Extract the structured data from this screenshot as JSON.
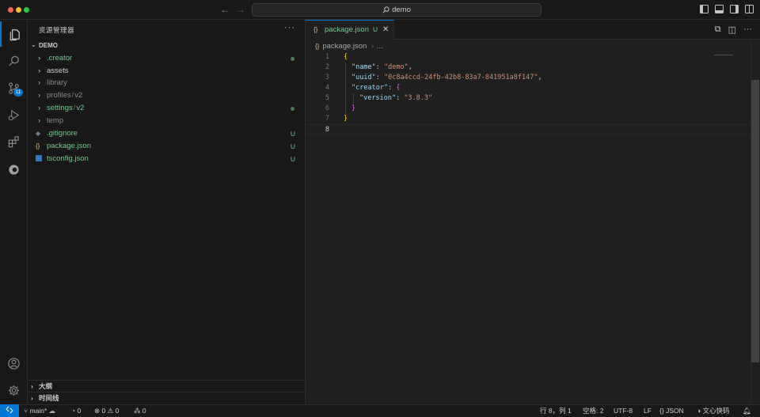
{
  "window": {
    "search_text": "demo"
  },
  "activity": {
    "scm_badge": "11"
  },
  "sidebar": {
    "title": "资源管理器",
    "more": "···",
    "root_folder": "DEMO",
    "items": [
      {
        "label": ".creator",
        "type": "folder",
        "status": "dot"
      },
      {
        "label": "assets",
        "type": "folder",
        "status": ""
      },
      {
        "label": "library",
        "type": "folder",
        "status": ""
      },
      {
        "label": "profiles",
        "label2": "v2",
        "type": "folder",
        "status": ""
      },
      {
        "label": "settings",
        "label2": "v2",
        "type": "folder",
        "status": "dot"
      },
      {
        "label": "temp",
        "type": "folder",
        "status": ""
      },
      {
        "label": ".gitignore",
        "type": "file",
        "status": "U"
      },
      {
        "label": "package.json",
        "type": "file",
        "status": "U"
      },
      {
        "label": "tsconfig.json",
        "type": "file",
        "status": "U"
      }
    ],
    "outline_label": "大纲",
    "timeline_label": "时间线"
  },
  "editor": {
    "tab_icon": "{}",
    "tab_name": "package.json",
    "tab_status": "U",
    "breadcrumb_file": "package.json",
    "breadcrumb_more": "…",
    "lines": [
      "{",
      "\"name\": \"demo\",",
      "\"uuid\": \"0c8a4ccd-24fb-42b8-83a7-841951a8f147\",",
      "\"creator\": {",
      "\"version\": \"3.8.3\"",
      "}",
      "}",
      ""
    ],
    "line_numbers": [
      "1",
      "2",
      "3",
      "4",
      "5",
      "6",
      "7",
      "8"
    ]
  },
  "statusbar": {
    "branch": "main*",
    "sync_count": "0",
    "errors": "0",
    "warnings": "0",
    "ports": "0",
    "cursor_pos": "行 8，列 1",
    "spaces": "空格: 2",
    "encoding": "UTF-8",
    "eol": "LF",
    "language": "JSON",
    "extension": "文心快码"
  },
  "colors": {
    "accent": "#0078d4",
    "git_untracked": "#73c991",
    "json_key": "#9cdcfe",
    "json_string": "#ce9178",
    "bracket_level1": "#ffd700",
    "bracket_level2": "#da70d6"
  }
}
